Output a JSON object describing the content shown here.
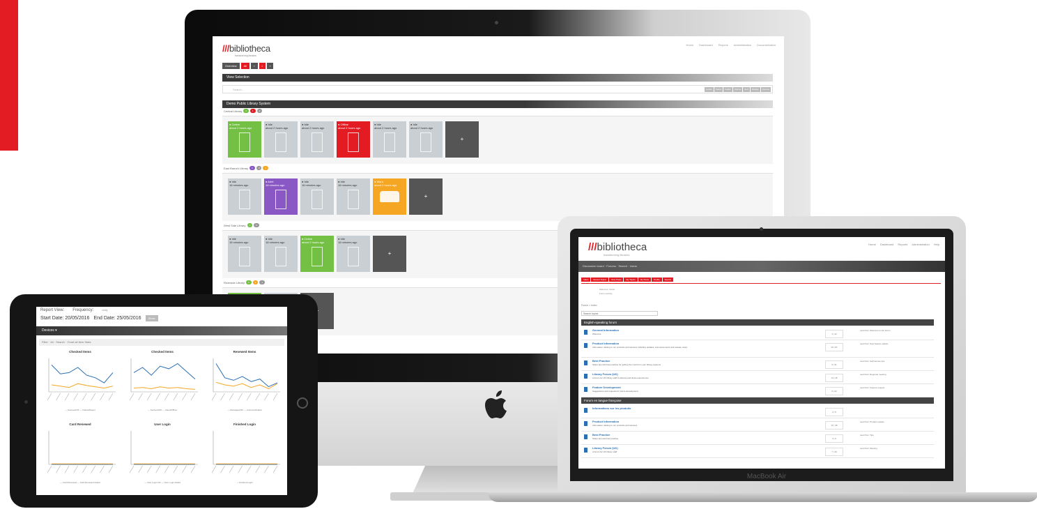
{
  "imac": {
    "brand": "bibliotheca",
    "brand_tag": "transforming libraries",
    "nav": [
      "Home",
      "Dashboard",
      "Reports",
      "Administration",
      "Documentation"
    ],
    "buttons": [
      "Overview",
      "All",
      "",
      "",
      ""
    ],
    "view_selection": "View Selection",
    "search_placeholder": "Search...",
    "search_opts": [
      "Locate",
      "Status",
      "Folder",
      "Uptime",
      "Sort",
      "Display",
      "Options"
    ],
    "library_bar": "Demo Public Library System",
    "groups": [
      {
        "label": "Central Library",
        "pills": [
          {
            "text": "3",
            "color": "#73c045"
          },
          {
            "text": "1",
            "color": "#e31c23"
          },
          {
            "text": "2",
            "color": "#999999"
          }
        ],
        "tiles": [
          {
            "status": "Online",
            "time": "about 2 hours ago",
            "color": "green"
          },
          {
            "status": "Idle",
            "time": "about 2 hours ago",
            "color": "grey"
          },
          {
            "status": "Idle",
            "time": "about 2 hours ago",
            "color": "grey"
          },
          {
            "status": "Offline",
            "time": "about 2 hours ago",
            "color": "red"
          },
          {
            "status": "Idle",
            "time": "about 2 hours ago",
            "color": "grey"
          },
          {
            "status": "Idle",
            "time": "about 2 hours ago",
            "color": "grey"
          }
        ]
      },
      {
        "label": "East Branch Library",
        "pills": [
          {
            "text": "1",
            "color": "#8a58c4"
          },
          {
            "text": "3",
            "color": "#999999"
          },
          {
            "text": "1",
            "color": "#f5a623"
          }
        ],
        "tiles": [
          {
            "status": "Idle",
            "time": "16 minutes ago",
            "color": "grey"
          },
          {
            "status": "Alert",
            "time": "16 minutes ago",
            "color": "purple"
          },
          {
            "status": "Idle",
            "time": "16 minutes ago",
            "color": "grey"
          },
          {
            "status": "Idle",
            "time": "16 minutes ago",
            "color": "grey"
          },
          {
            "status": "Warn",
            "time": "about 2 hours ago",
            "color": "orange"
          }
        ]
      },
      {
        "label": "West Side Library",
        "pills": [
          {
            "text": "1",
            "color": "#73c045"
          },
          {
            "text": "3",
            "color": "#999999"
          }
        ],
        "tiles": [
          {
            "status": "Idle",
            "time": "16 minutes ago",
            "color": "grey"
          },
          {
            "status": "Idle",
            "time": "16 minutes ago",
            "color": "grey"
          },
          {
            "status": "Online",
            "time": "about 2 hours ago",
            "color": "green"
          },
          {
            "status": "Idle",
            "time": "16 minutes ago",
            "color": "grey"
          }
        ]
      },
      {
        "label": "Riverside Library",
        "pills": [
          {
            "text": "2",
            "color": "#73c045"
          },
          {
            "text": "1",
            "color": "#f5a623"
          },
          {
            "text": "1",
            "color": "#999999"
          }
        ],
        "tiles": [
          {
            "status": "Online",
            "time": "16 minutes ago",
            "color": "green"
          },
          {
            "status": "Idle",
            "time": "16 minutes ago",
            "color": "grey"
          }
        ]
      }
    ],
    "add_symbol": "+"
  },
  "macbook": {
    "brand": "bibliotheca",
    "brand_tag": "transforming libraries",
    "label": "MacBook Air",
    "nav": [
      "Home",
      "Dashboard",
      "Reports",
      "Administration",
      "Help"
    ],
    "bar_text": "Discussion board · Forums · Search · Users",
    "tabs": [
      "Index",
      "Recent Topics",
      "New Posts",
      "My Topics",
      "My Posts",
      "Profile",
      "Search"
    ],
    "info": [
      "Welcome, Guest",
      "Forum activity"
    ],
    "crumb": "Forum > Index",
    "search": "Search topics",
    "sections": [
      {
        "title": "English-speaking forum",
        "rows": [
          {
            "title": "General Information",
            "desc": "Welcome",
            "count": "4 | 12",
            "last": "Last Post: Welcome to the forum"
          },
          {
            "title": "Product Information",
            "desc": "Information relating to our products and services including updates, announcements and release notes",
            "count": "20 | 87",
            "last": "Last Post: New feature update"
          },
          {
            "title": "Best Practice",
            "desc": "Share tips and best practice for getting the most from your library systems",
            "count": "9 | 31",
            "last": "Last Post: Self-service tips"
          },
          {
            "title": "Library Forum (UK)",
            "desc": "A forum for UK library staff to discuss and share experiences",
            "count": "14 | 45",
            "last": "Last Post: Regional meeting"
          },
          {
            "title": "Feature Development",
            "desc": "Suggestions and requests for future development",
            "count": "6 | 22",
            "last": "Last Post: Feature request"
          }
        ]
      },
      {
        "title": "Forum en langue française",
        "rows": [
          {
            "title": "Informations sur les produits",
            "desc": "",
            "count": "2 | 5",
            "last": ""
          },
          {
            "title": "Product Information",
            "desc": "Information relating to our products and services",
            "count": "11 | 38",
            "last": "Last Post: Product update"
          },
          {
            "title": "Best Practice",
            "desc": "Share tips and best practice",
            "count": "3 | 9",
            "last": "Last Post: Tips"
          },
          {
            "title": "Library Forum (UK)",
            "desc": "A forum for UK library staff",
            "count": "7 | 19",
            "last": "Last Post: Meeting"
          }
        ]
      }
    ]
  },
  "ipad": {
    "report_view": "Report View:",
    "frequency": "Frequency:",
    "frequency_value": "daily",
    "start_date": "Start Date: 20/05/2016",
    "end_date": "End Date: 25/05/2016",
    "show_button": "Show",
    "bar": "Devices ▾",
    "filter": "Filter · All · Search · Chart all Item Stats",
    "charts": [
      {
        "title": "Checked Items",
        "legend": "— Success/OK   — Failure/Reject",
        "s1": [
          42,
          28,
          30,
          38,
          26,
          22,
          14,
          30
        ],
        "s2": [
          10,
          8,
          6,
          12,
          9,
          7,
          5,
          8
        ]
      },
      {
        "title": "Checked Items",
        "legend": "— Success/OK   — Client/Offline",
        "s1": [
          30,
          38,
          26,
          40,
          36,
          44,
          32,
          20
        ],
        "s2": [
          5,
          6,
          4,
          7,
          5,
          6,
          4,
          3
        ]
      },
      {
        "title": "Renewed Items",
        "legend": "— Messages/OK   — Unknown/Failed",
        "s1": [
          44,
          22,
          18,
          24,
          16,
          20,
          8,
          14
        ],
        "s2": [
          14,
          10,
          8,
          12,
          6,
          10,
          4,
          12
        ]
      },
      {
        "title": "Card Renewed",
        "legend": "— Card Renewed   — Card Renewed Failed",
        "s1": [
          0,
          0,
          0,
          0,
          0,
          0,
          0,
          0
        ],
        "s2": [
          0,
          0,
          0,
          0,
          0,
          0,
          0,
          0
        ]
      },
      {
        "title": "User Login",
        "legend": "— User Login OK   — User Login Failed",
        "s1": [
          0,
          0,
          0,
          0,
          0,
          0,
          0,
          0
        ],
        "s2": [
          0,
          0,
          0,
          0,
          0,
          0,
          0,
          0
        ]
      },
      {
        "title": "Finished Login",
        "legend": "— Finished Login",
        "s1": [
          0,
          0,
          0,
          0,
          0,
          0,
          0,
          0
        ],
        "s2": [
          0,
          0,
          0,
          0,
          0,
          0,
          0,
          0
        ]
      }
    ]
  },
  "colors": {
    "brand_red": "#e31c23",
    "green": "#73c045",
    "purple": "#8a58c4",
    "orange": "#f5a623",
    "line_blue": "#2a6fb3",
    "line_orange": "#f5a623"
  }
}
